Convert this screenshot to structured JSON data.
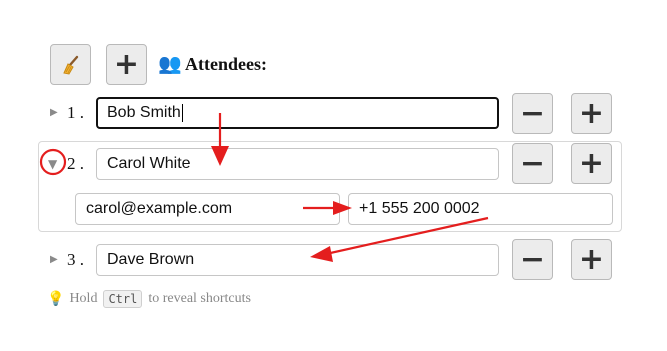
{
  "header": {
    "clear_icon": "broom-icon",
    "add_symbol": "+",
    "title_icon": "👥",
    "title": "Attendees:"
  },
  "attendees": [
    {
      "number": "1",
      "dot": ".",
      "name": "Bob Smith",
      "expanded": false,
      "remove_symbol": "−",
      "add_symbol": "+"
    },
    {
      "number": "2",
      "dot": ".",
      "name": "Carol White",
      "expanded": true,
      "email": "carol@example.com",
      "phone": "+1 555 200 0002",
      "remove_symbol": "−",
      "add_symbol": "+"
    },
    {
      "number": "3",
      "dot": ".",
      "name": "Dave Brown",
      "expanded": false,
      "remove_symbol": "−",
      "add_symbol": "+"
    }
  ],
  "triangle": {
    "collapsed": "▶",
    "expanded": "▼"
  },
  "hint": {
    "icon": "💡",
    "before": "Hold",
    "key": "Ctrl",
    "after": "to reveal shortcuts"
  },
  "annotation_color": "#e41e1e"
}
